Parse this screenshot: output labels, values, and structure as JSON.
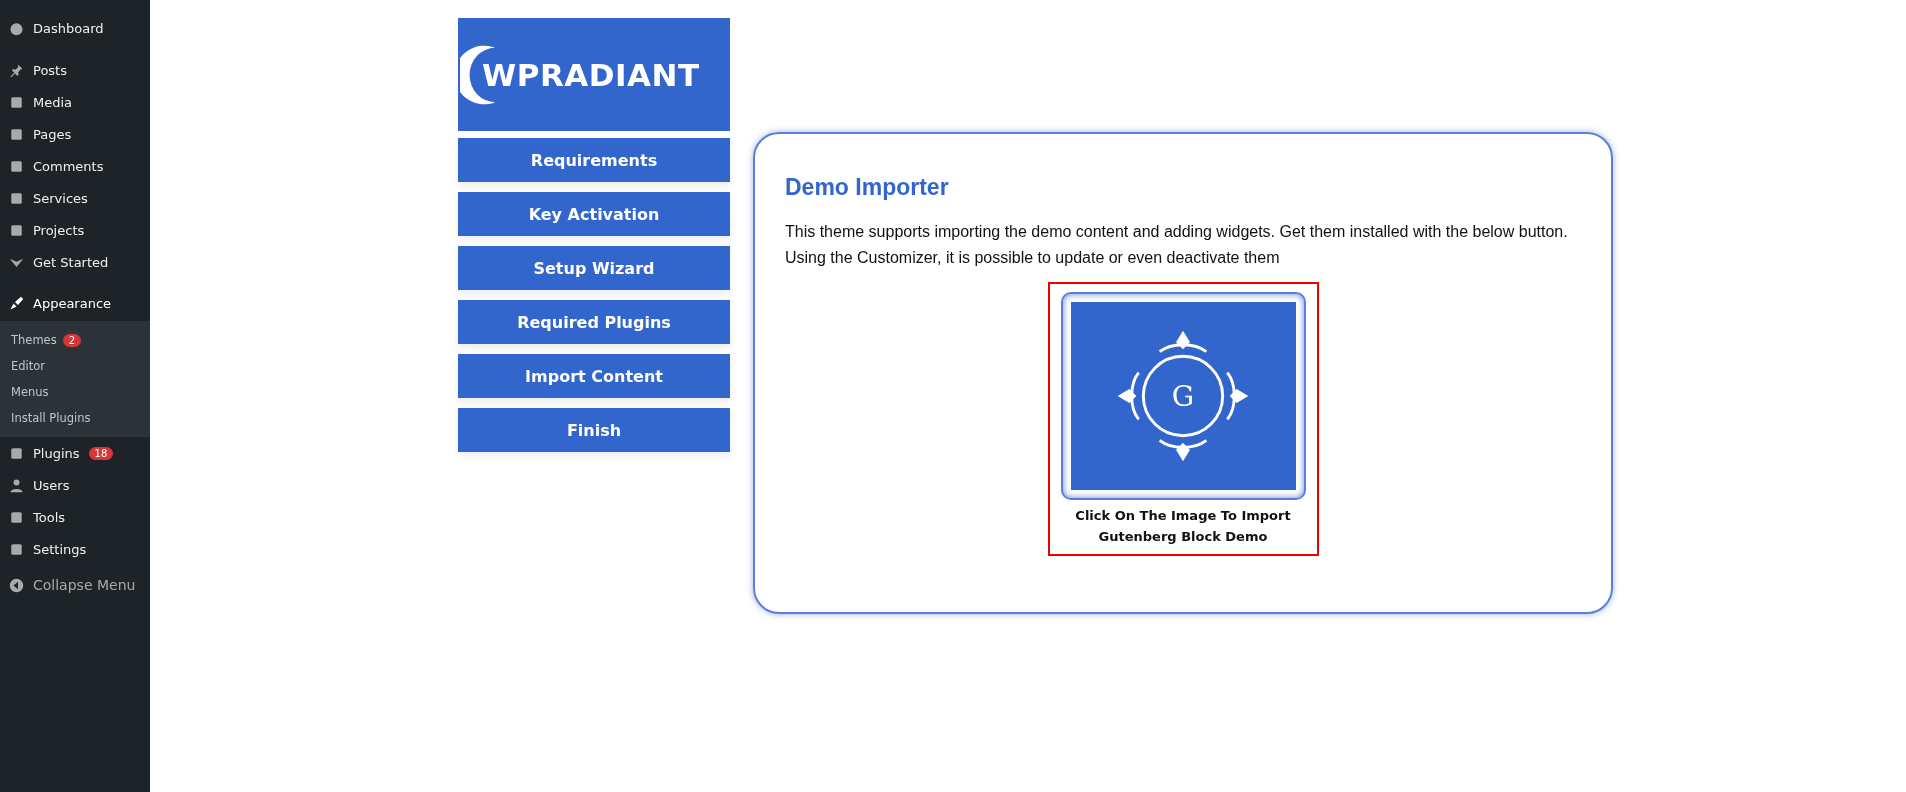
{
  "sidebar": {
    "items": [
      {
        "label": "Dashboard",
        "selected": false
      },
      {
        "label": "Posts",
        "selected": false
      },
      {
        "label": "Media",
        "selected": false
      },
      {
        "label": "Pages",
        "selected": false
      },
      {
        "label": "Comments",
        "selected": false
      },
      {
        "label": "Services",
        "selected": false
      },
      {
        "label": "Projects",
        "selected": false
      },
      {
        "label": "Get Started",
        "selected": false
      },
      {
        "label": "Appearance",
        "selected": true,
        "expanded": true,
        "children": [
          {
            "label": "Themes",
            "badge": "2"
          },
          {
            "label": "Editor"
          },
          {
            "label": "Menus"
          },
          {
            "label": "Install Plugins"
          }
        ]
      },
      {
        "label": "Plugins",
        "selected": false,
        "badge": "18"
      },
      {
        "label": "Users",
        "selected": false
      },
      {
        "label": "Tools",
        "selected": false
      },
      {
        "label": "Settings",
        "selected": false
      }
    ],
    "collapse": "Collapse Menu"
  },
  "logo": {
    "text": "WPRADIANT"
  },
  "steps": [
    "Requirements",
    "Key Activation",
    "Setup Wizard",
    "Required Plugins",
    "Import Content",
    "Finish"
  ],
  "panel": {
    "title": "Demo Importer",
    "description": "This theme supports importing the demo content and adding widgets. Get them installed with the below button. Using the Customizer, it is possible to update or even deactivate them",
    "demo": {
      "monogram": "G",
      "caption": "Click On The Image To Import Gutenberg Block Demo"
    }
  }
}
